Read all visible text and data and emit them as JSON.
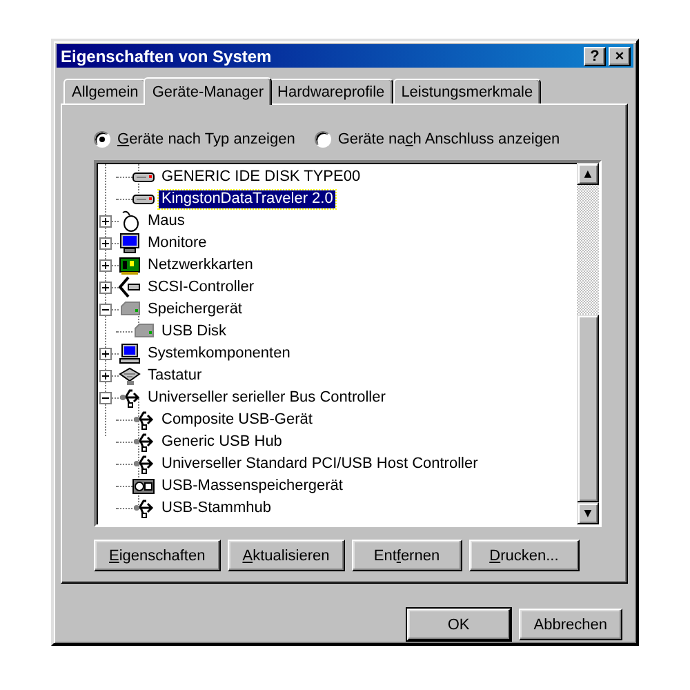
{
  "window": {
    "title": "Eigenschaften von System",
    "title_buttons": [
      "?",
      "×"
    ]
  },
  "tabs": [
    {
      "label": "Allgemein",
      "selected": false
    },
    {
      "label": "Geräte-Manager",
      "selected": true
    },
    {
      "label": "Hardwareprofile",
      "selected": false
    },
    {
      "label": "Leistungsmerkmale",
      "selected": false
    }
  ],
  "view_options": [
    {
      "key": "G",
      "post": "eräte nach Typ anzeigen",
      "selected": true
    },
    {
      "pre": "Geräte na",
      "key": "c",
      "post": "h Anschluss anzeigen",
      "selected": false
    }
  ],
  "tree": [
    {
      "children": [
        {
          "label": "GENERIC IDE  DISK TYPE00",
          "kind": "disk",
          "selected": false
        },
        {
          "label": "KingstonDataTraveler 2.0",
          "kind": "disk",
          "selected": true
        }
      ]
    },
    {
      "label": "Maus",
      "kind": "mouse",
      "expanded": false,
      "selected": false
    },
    {
      "label": "Monitore",
      "kind": "monitor",
      "expanded": false,
      "selected": false
    },
    {
      "label": "Netzwerkkarten",
      "kind": "network",
      "expanded": false,
      "selected": false
    },
    {
      "label": "SCSI-Controller",
      "kind": "scsi",
      "expanded": false,
      "selected": false
    },
    {
      "label": "Speichergerät",
      "kind": "storage",
      "expanded": true,
      "selected": false,
      "children": [
        {
          "label": "USB Disk",
          "kind": "storage",
          "selected": false
        }
      ]
    },
    {
      "label": "Systemkomponenten",
      "kind": "system",
      "expanded": false,
      "selected": false
    },
    {
      "label": "Tastatur",
      "kind": "keyboard",
      "expanded": false,
      "selected": false
    },
    {
      "label": "Universeller serieller Bus Controller",
      "kind": "usb",
      "expanded": true,
      "selected": false,
      "children": [
        {
          "label": "Composite USB-Gerät",
          "kind": "usb",
          "selected": false
        },
        {
          "label": "Generic USB Hub",
          "kind": "usb",
          "selected": false
        },
        {
          "label": "Universeller Standard PCI/USB Host Controller",
          "kind": "usb",
          "selected": false
        },
        {
          "label": "USB-Massenspeichergerät",
          "kind": "massstorage",
          "selected": false
        },
        {
          "label": "USB-Stammhub",
          "kind": "usb",
          "selected": false
        }
      ]
    }
  ],
  "scroll_arrows": [
    "▲",
    "▼"
  ],
  "panel_buttons": [
    {
      "key": "E",
      "post": "igenschaften"
    },
    {
      "key": "A",
      "post": "ktualisieren"
    },
    {
      "pre": "Ent",
      "key": "f",
      "post": "ernen"
    },
    {
      "key": "D",
      "post": "rucken..."
    }
  ],
  "dialog_buttons": [
    {
      "label": "OK",
      "default": true
    },
    {
      "label": "Abbrechen",
      "default": false
    }
  ]
}
